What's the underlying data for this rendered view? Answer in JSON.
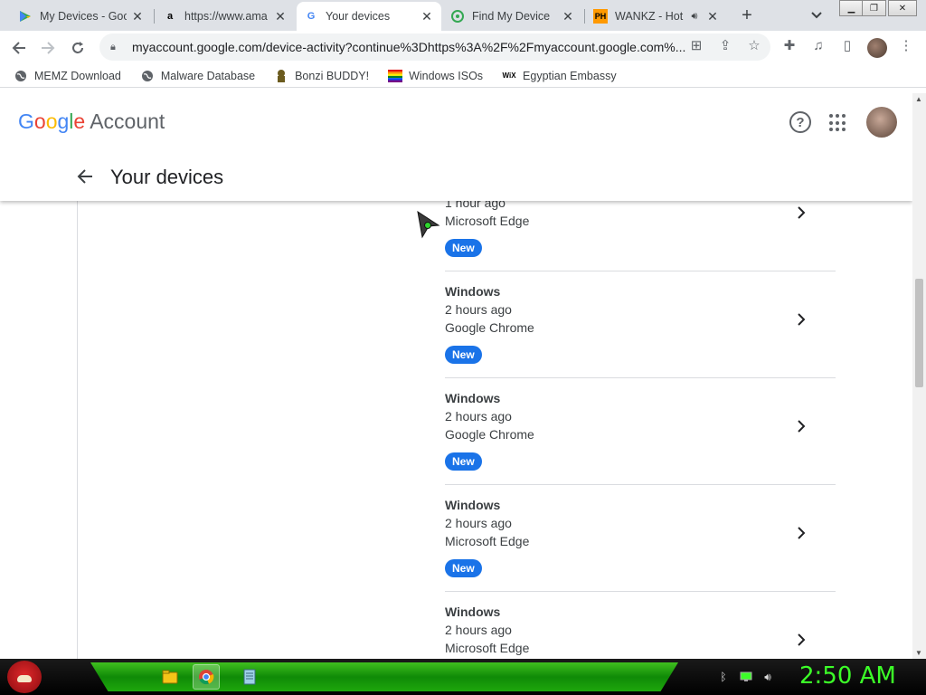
{
  "browser": {
    "tabs": [
      {
        "title": "My Devices - Goo",
        "favicon": "play-store-icon",
        "active": false
      },
      {
        "title": "https://www.ama",
        "favicon": "amazon-icon",
        "active": false
      },
      {
        "title": "Your devices",
        "favicon": "google-icon",
        "active": true
      },
      {
        "title": "Find My Device",
        "favicon": "find-my-device-icon",
        "active": false
      },
      {
        "title": "WANKZ - Hot",
        "favicon": "ph-icon",
        "active": false
      }
    ],
    "url": "myaccount.google.com/device-activity?continue%3Dhttps%3A%2F%2Fmyaccount.google.com%...",
    "bookmarks": [
      {
        "label": "MEMZ Download",
        "icon": "globe-icon"
      },
      {
        "label": "Malware Database",
        "icon": "globe-icon"
      },
      {
        "label": "Bonzi BUDDY!",
        "icon": "bonzi-icon"
      },
      {
        "label": "Windows ISOs",
        "icon": "rainbow-flag-icon"
      },
      {
        "label": "Egyptian Embassy",
        "icon": "wix-icon",
        "icon_text": "WiX"
      }
    ]
  },
  "page": {
    "brand_google": "Google",
    "brand_account": "Account",
    "title": "Your devices",
    "devices": [
      {
        "name": "",
        "time": "1 hour ago",
        "browser": "Microsoft Edge",
        "badge": "New"
      },
      {
        "name": "Windows",
        "time": "2 hours ago",
        "browser": "Google Chrome",
        "badge": "New"
      },
      {
        "name": "Windows",
        "time": "2 hours ago",
        "browser": "Google Chrome",
        "badge": "New"
      },
      {
        "name": "Windows",
        "time": "2 hours ago",
        "browser": "Microsoft Edge",
        "badge": "New"
      },
      {
        "name": "Windows",
        "time": "2 hours ago",
        "browser": "Microsoft Edge",
        "badge": ""
      }
    ]
  },
  "taskbar": {
    "clock": "2:50 AM"
  },
  "colors": {
    "badge": "#1a73e8",
    "clock": "#3cff28",
    "taskbar_glow": "#1ea70c"
  }
}
